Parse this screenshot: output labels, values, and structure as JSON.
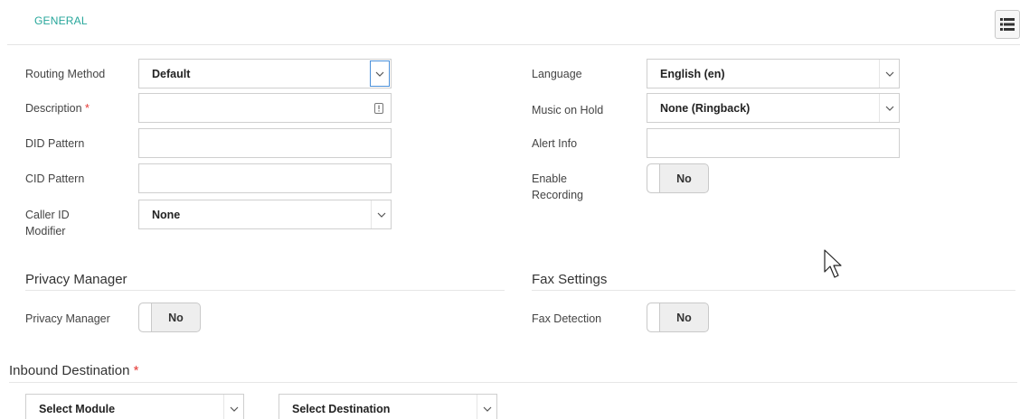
{
  "header": {
    "tab_general": "GENERAL",
    "list_icon": "list-icon"
  },
  "left_form": {
    "routing_method_label": "Routing Method",
    "routing_method_value": "Default",
    "description_label": "Description",
    "description_required": "*",
    "description_value": "",
    "did_pattern_label": "DID Pattern",
    "did_pattern_value": "",
    "cid_pattern_label": "CID Pattern",
    "cid_pattern_value": "",
    "caller_id_modifier_label_1": "Caller ID",
    "caller_id_modifier_label_2": "Modifier",
    "caller_id_modifier_value": "None"
  },
  "right_form": {
    "language_label": "Language",
    "language_value": "English (en)",
    "music_on_hold_label": "Music on Hold",
    "music_on_hold_value": "None (Ringback)",
    "alert_info_label": "Alert Info",
    "alert_info_value": "",
    "enable_recording_label_1": "Enable",
    "enable_recording_label_2": "Recording",
    "enable_recording_value": "No"
  },
  "privacy_section": {
    "title": "Privacy Manager",
    "privacy_manager_label": "Privacy Manager",
    "privacy_manager_value": "No"
  },
  "fax_section": {
    "title": "Fax Settings",
    "fax_detection_label": "Fax Detection",
    "fax_detection_value": "No"
  },
  "inbound_section": {
    "title": "Inbound Destination",
    "required": "*",
    "module_value": "Select Module",
    "destination_value": "Select Destination"
  }
}
